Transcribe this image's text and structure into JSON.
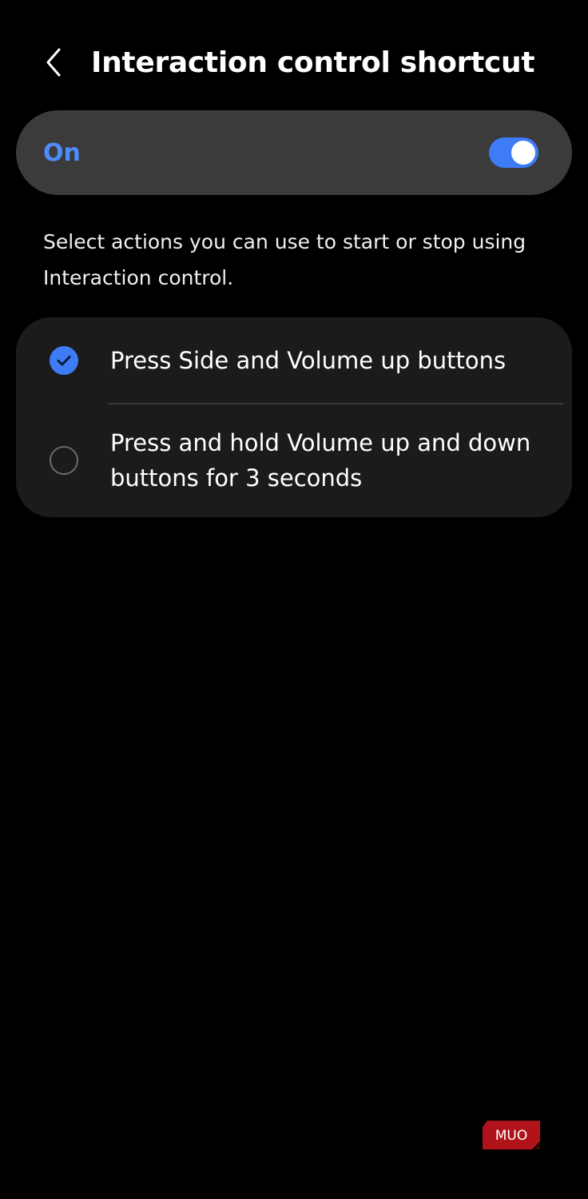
{
  "header": {
    "title": "Interaction control shortcut",
    "back_icon": "chevron-left-icon"
  },
  "master_toggle": {
    "label": "On",
    "state": "on",
    "accent_color": "#3d7cf5",
    "label_color": "#4f8dff"
  },
  "description": "Select actions you can use to start or stop using Interaction control.",
  "options": [
    {
      "label": "Press Side and Volume up buttons",
      "selected": true
    },
    {
      "label": "Press and hold Volume up and down buttons for 3 seconds",
      "selected": false
    }
  ],
  "watermark": {
    "text": "MUO",
    "color": "#b0141a"
  },
  "colors": {
    "background": "#000000",
    "master_card": "#3b3b3b",
    "options_card": "#1b1b1b"
  }
}
